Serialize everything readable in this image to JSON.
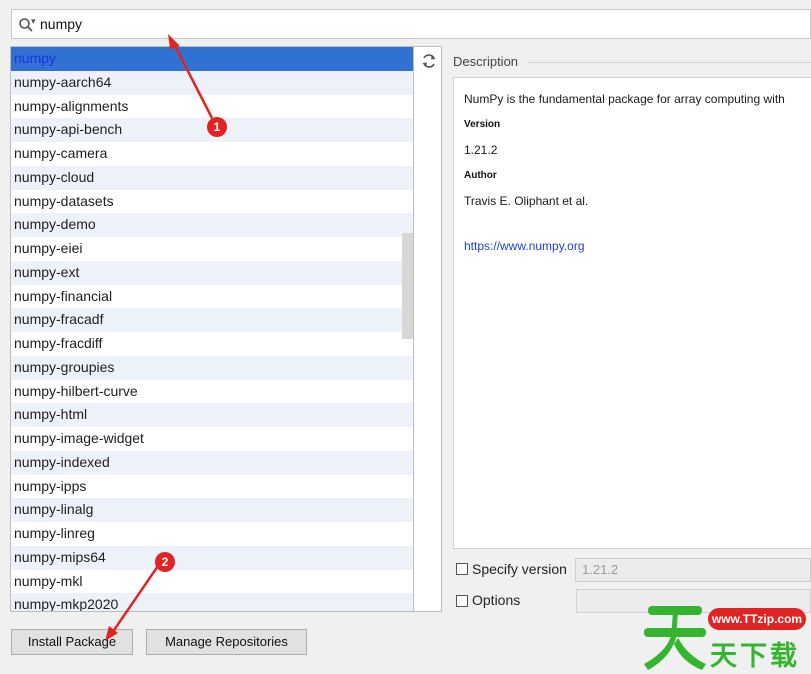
{
  "search": {
    "value": "numpy"
  },
  "packages": [
    "numpy",
    "numpy-aarch64",
    "numpy-alignments",
    "numpy-api-bench",
    "numpy-camera",
    "numpy-cloud",
    "numpy-datasets",
    "numpy-demo",
    "numpy-eiei",
    "numpy-ext",
    "numpy-financial",
    "numpy-fracadf",
    "numpy-fracdiff",
    "numpy-groupies",
    "numpy-hilbert-curve",
    "numpy-html",
    "numpy-image-widget",
    "numpy-indexed",
    "numpy-ipps",
    "numpy-linalg",
    "numpy-linreg",
    "numpy-mips64",
    "numpy-mkl",
    "numpy-mkp2020"
  ],
  "selected_index": 0,
  "description": {
    "header": "Description",
    "summary": "NumPy is the fundamental package for array computing with",
    "version_label": "Version",
    "version_value": "1.21.2",
    "author_label": "Author",
    "author_value": "Travis E. Oliphant et al.",
    "homepage": "https://www.numpy.org"
  },
  "options": {
    "specify_version_label": "Specify version",
    "specify_version_value": "1.21.2",
    "options_label": "Options"
  },
  "buttons": {
    "install": "Install Package",
    "manage": "Manage Repositories"
  },
  "annotations": {
    "one": "1",
    "two": "2"
  },
  "watermark": {
    "url": "www.TTzip.com",
    "text": "天下载"
  },
  "colors": {
    "selection": "#2f72d1",
    "selected_text": "#1a33e6",
    "link": "#1f3fd4",
    "annotation": "#e02424",
    "watermark_green": "#35b52f"
  },
  "icons": {
    "search": "search-icon",
    "refresh": "refresh-icon"
  }
}
